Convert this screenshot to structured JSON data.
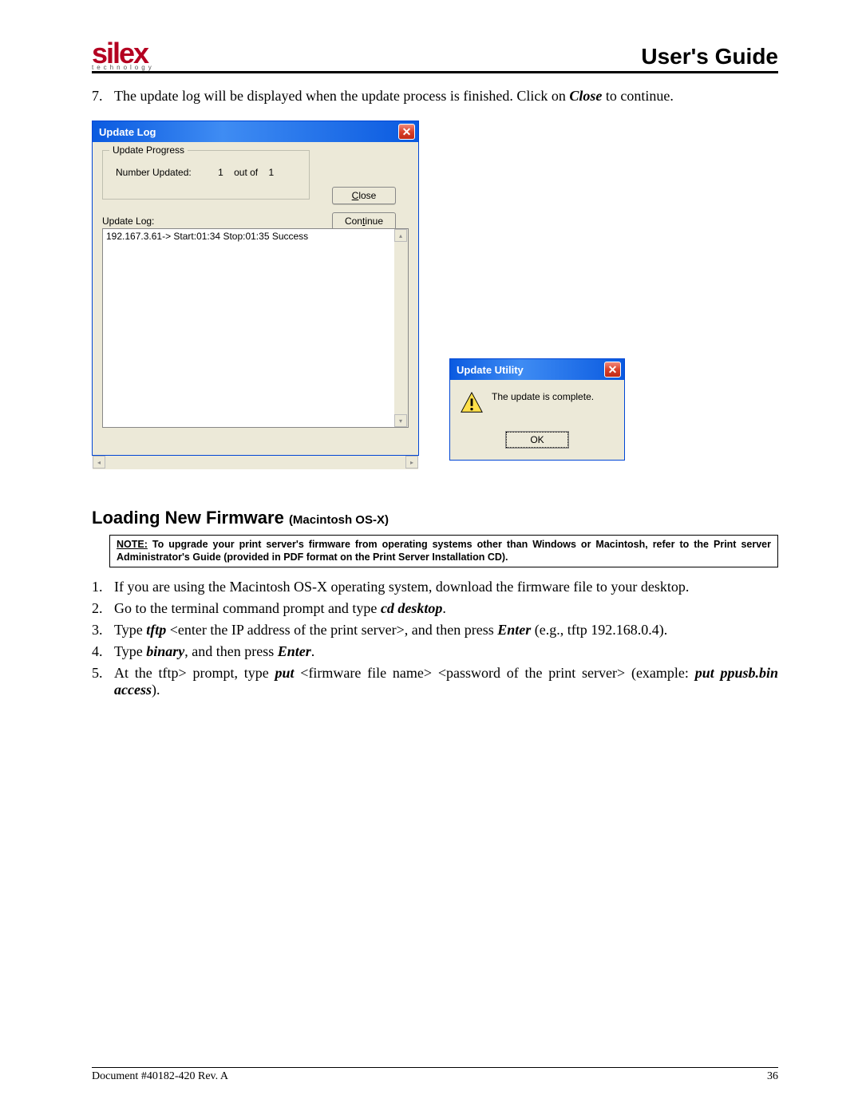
{
  "header": {
    "logo": {
      "main": "silex",
      "sub": "technology"
    },
    "title": "User's Guide"
  },
  "step7": {
    "num": "7.",
    "text_a": "The update log will be displayed when the update process is finished.  Click on ",
    "text_close": "Close",
    "text_b": " to continue."
  },
  "update_log": {
    "title": "Update Log",
    "progress_legend": "Update Progress",
    "number_label": "Number Updated:",
    "number_value": "1",
    "outof": "out of",
    "number_total": "1",
    "close_btn_pre": "C",
    "close_btn_rest": "lose",
    "continue_btn_pre": "Con",
    "continue_btn_ul": "t",
    "continue_btn_rest": "inue",
    "log_label": "Update Log:",
    "log_entry": "192.167.3.61-> Start:01:34 Stop:01:35  Success"
  },
  "update_utility": {
    "title": "Update Utility",
    "message": "The update is complete.",
    "ok": "OK"
  },
  "section": {
    "heading_a": "Loading New Firmware ",
    "heading_b": "(Macintosh OS-X)"
  },
  "note": {
    "label": "NOTE:",
    "text": " To upgrade your print server's firmware from operating systems other than Windows or Macintosh, refer to the Print server Administrator's Guide (provided in PDF format on the Print Server Installation CD)."
  },
  "steps": [
    {
      "n": "1.",
      "parts": [
        {
          "t": "If you are using the Macintosh OS-X operating system, download the firmware file to your desktop."
        }
      ]
    },
    {
      "n": "2.",
      "parts": [
        {
          "t": "Go to the terminal command prompt and type "
        },
        {
          "bi": "cd desktop"
        },
        {
          "t": "."
        }
      ]
    },
    {
      "n": "3.",
      "parts": [
        {
          "t": "Type "
        },
        {
          "bi": "tftp"
        },
        {
          "t": " <enter the IP address of the print server>, and then press "
        },
        {
          "bi": "Enter"
        },
        {
          "t": " (e.g., tftp 192.168.0.4)."
        }
      ]
    },
    {
      "n": "4.",
      "parts": [
        {
          "t": "Type "
        },
        {
          "bi": "binary"
        },
        {
          "t": ", and then press "
        },
        {
          "bi": "Enter"
        },
        {
          "t": "."
        }
      ]
    },
    {
      "n": "5.",
      "parts": [
        {
          "t": "At the tftp> prompt, type "
        },
        {
          "bi": "put"
        },
        {
          "t": " <firmware file name> <password of the print server> (example: "
        },
        {
          "bi": "put ppusb.bin access"
        },
        {
          "t": ")."
        }
      ]
    }
  ],
  "footer": {
    "doc": "Document #40182-420  Rev. A",
    "page": "36"
  }
}
